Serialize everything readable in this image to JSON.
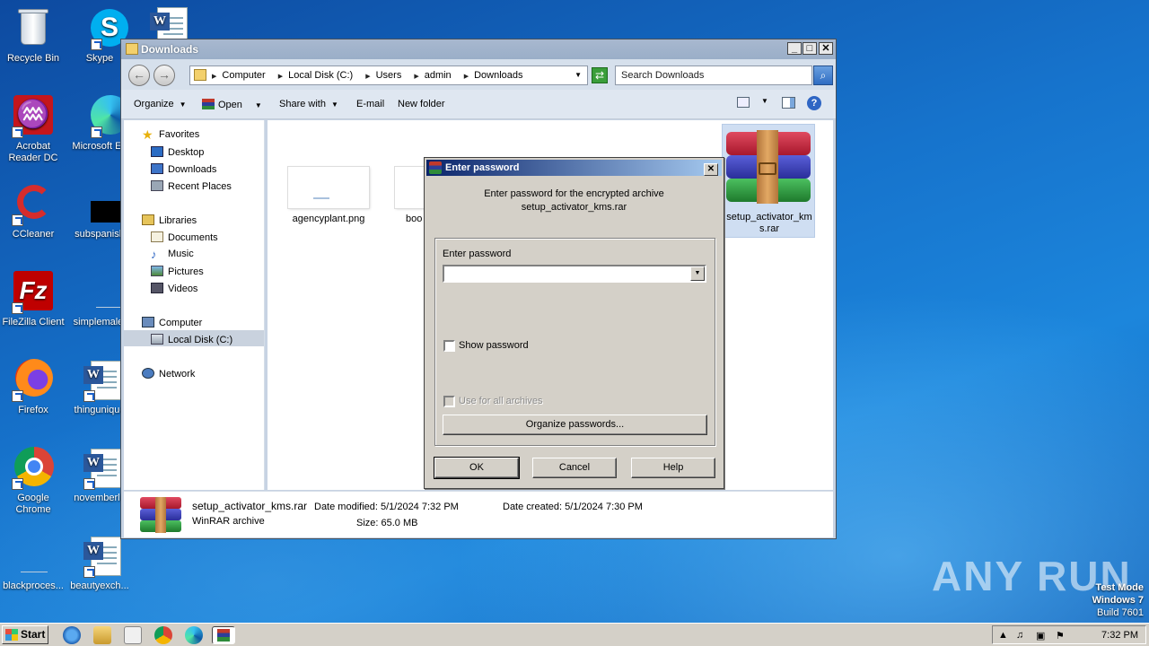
{
  "desktop": {
    "icons_col1": [
      {
        "label": "Recycle Bin"
      },
      {
        "label": "Acrobat Reader DC"
      },
      {
        "label": "CCleaner"
      },
      {
        "label": "FileZilla Client"
      },
      {
        "label": "Firefox"
      },
      {
        "label": "Google Chrome"
      },
      {
        "label": "blackproces..."
      }
    ],
    "icons_col2": [
      {
        "label": "Skype"
      },
      {
        "label": "Microsoft Ed"
      },
      {
        "label": "subspanish"
      },
      {
        "label": "simplemale."
      },
      {
        "label": "thingunique"
      },
      {
        "label": "novemberlo"
      },
      {
        "label": "beautyexch..."
      }
    ]
  },
  "explorer": {
    "title": "Downloads",
    "address": {
      "crumbs": [
        "Computer",
        "Local Disk (C:)",
        "Users",
        "admin",
        "Downloads"
      ]
    },
    "search": {
      "placeholder": "Search Downloads"
    },
    "toolbar": {
      "organize": "Organize",
      "open": "Open",
      "share_with": "Share with",
      "email": "E-mail",
      "new_folder": "New folder"
    },
    "nav": {
      "favorites": "Favorites",
      "desktop": "Desktop",
      "downloads": "Downloads",
      "recent_places": "Recent Places",
      "libraries": "Libraries",
      "documents": "Documents",
      "music": "Music",
      "pictures": "Pictures",
      "videos": "Videos",
      "computer": "Computer",
      "local_disk": "Local Disk (C:)",
      "network": "Network"
    },
    "files": [
      {
        "name": "agencyplant.png"
      },
      {
        "name": "boo"
      },
      {
        "name": "setup_activator_kms.rar"
      }
    ],
    "details": {
      "file_name": "setup_activator_kms.rar",
      "file_type": "WinRAR archive",
      "date_modified": "Date modified: 5/1/2024 7:32 PM",
      "size": "Size: 65.0 MB",
      "date_created": "Date created: 5/1/2024 7:30 PM"
    }
  },
  "password_dialog": {
    "title": "Enter password",
    "message_line1": "Enter password for the encrypted archive",
    "message_line2": "setup_activator_kms.rar",
    "field_label": "Enter password",
    "field_value": "",
    "show_password": "Show password",
    "use_for_all": "Use for all archives",
    "organize_passwords": "Organize passwords...",
    "ok": "OK",
    "cancel": "Cancel",
    "help": "Help"
  },
  "watermark": {
    "brand": "ANY RUN",
    "test_mode": "Test Mode",
    "os": "Windows 7",
    "build": "Build 7601"
  },
  "taskbar": {
    "start": "Start",
    "clock": "7:32 PM"
  },
  "colors": {
    "desktop_bg": "#1565b8",
    "dialog_title": "#0a246a",
    "dialog_face": "#d4d0c8"
  }
}
